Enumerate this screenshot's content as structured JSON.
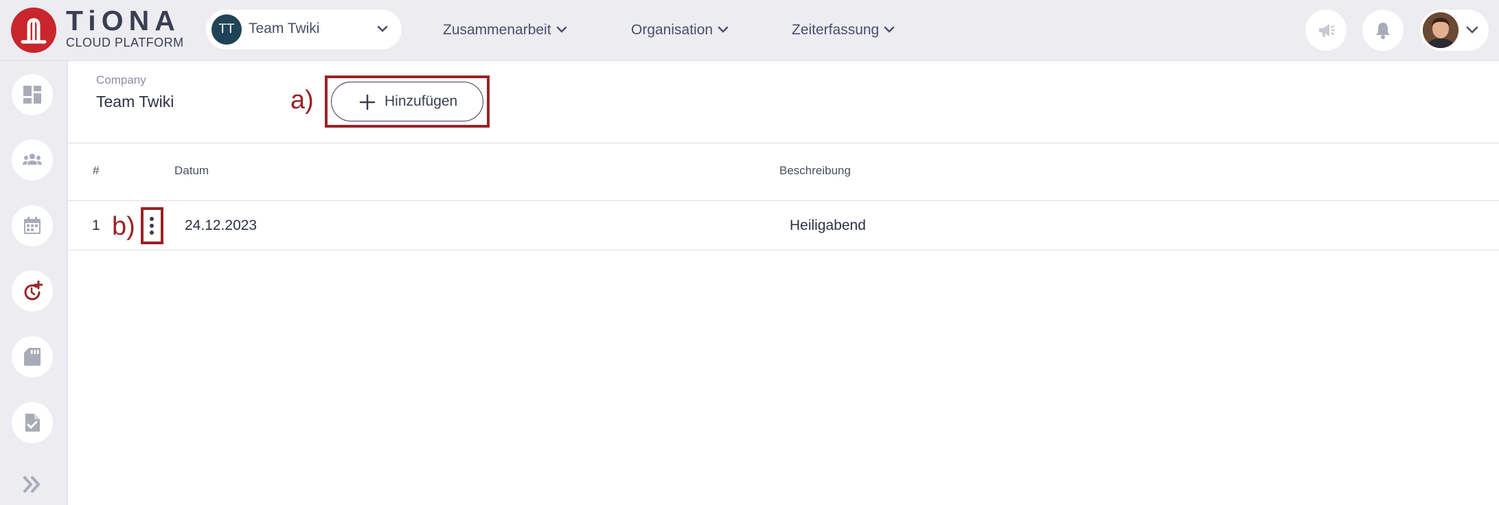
{
  "app": {
    "logo_word": "TiONA",
    "logo_subtitle": "CLOUD PLATFORM"
  },
  "team_switcher": {
    "initials": "TT",
    "name": "Team Twiki"
  },
  "nav": {
    "items": [
      {
        "label": "Zusammenarbeit"
      },
      {
        "label": "Organisation"
      },
      {
        "label": "Zeiterfassung"
      }
    ]
  },
  "header_icons": [
    "megaphone-icon",
    "bell-icon",
    "user-avatar",
    "chevron-down-icon"
  ],
  "sidebar": {
    "items": [
      {
        "icon": "dashboard-icon"
      },
      {
        "icon": "team-icon"
      },
      {
        "icon": "calendar-icon"
      },
      {
        "icon": "time-add-icon"
      },
      {
        "icon": "sd-card-icon"
      },
      {
        "icon": "document-check-icon"
      }
    ],
    "expand_icon": "double-chevron-right-icon"
  },
  "page": {
    "company_label": "Company",
    "company_name": "Team Twiki",
    "add_button_label": "Hinzufügen"
  },
  "annotations": {
    "a": "a)",
    "b": "b)"
  },
  "table": {
    "columns": [
      "#",
      "Datum",
      "Beschreibung"
    ],
    "rows": [
      {
        "index": "1",
        "date": "24.12.2023",
        "description": "Heiligabend"
      }
    ]
  },
  "colors": {
    "brand_red": "#c8262c",
    "annotation_red": "#9b2226",
    "background": "#ececf1",
    "team_avatar": "#1f4457"
  }
}
